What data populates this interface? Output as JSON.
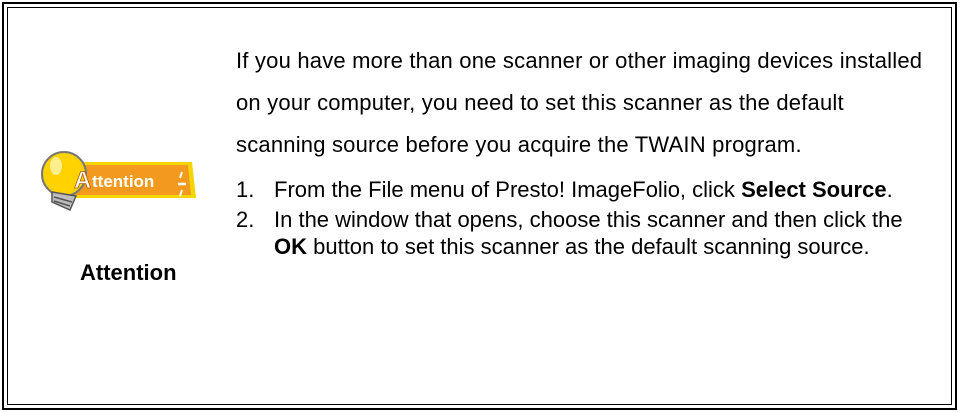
{
  "attention": {
    "badge_text": "ttention",
    "badge_initial": "A",
    "label": "Attention",
    "colors": {
      "badge_fill": "#f39a1e",
      "badge_border": "#f4d500",
      "bulb": "#ffd200",
      "bulb_outline": "#555555",
      "text": "#ffffff"
    }
  },
  "intro": "If you have more than one scanner or other imaging devices installed on your computer, you need to set this scanner as the default scanning source before you acquire the TWAIN program.",
  "steps": [
    {
      "number": "1.",
      "before": "From the File menu of Presto! ImageFolio, click ",
      "bold": "Select Source",
      "after": "."
    },
    {
      "number": "2.",
      "before": "In the window that opens, choose this scanner and then click the ",
      "bold": "OK",
      "after": " button to set this scanner as the default scanning source."
    }
  ]
}
